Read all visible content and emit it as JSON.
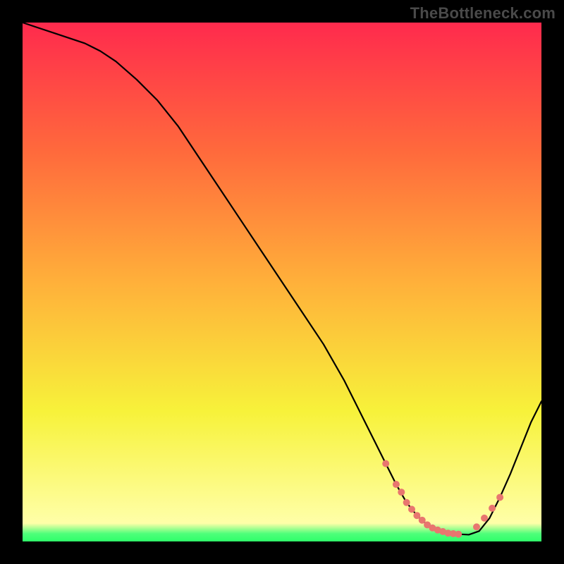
{
  "watermark": "TheBottleneck.com",
  "chart_data": {
    "type": "line",
    "title": "",
    "xlabel": "",
    "ylabel": "",
    "xlim": [
      0,
      100
    ],
    "ylim": [
      0,
      100
    ],
    "series": [
      {
        "name": "curve",
        "x": [
          0,
          3,
          6,
          9,
          12,
          15,
          18,
          22,
          26,
          30,
          34,
          38,
          42,
          46,
          50,
          54,
          58,
          62,
          64,
          66,
          68,
          70,
          72,
          74,
          76,
          78,
          80,
          82,
          84,
          86,
          88,
          90,
          92,
          94,
          96,
          98,
          100
        ],
        "y": [
          100,
          99,
          98,
          97,
          96,
          94.5,
          92.5,
          89,
          85,
          80,
          74,
          68,
          62,
          56,
          50,
          44,
          38,
          31,
          27,
          23,
          19,
          15,
          11,
          7.5,
          5,
          3.2,
          2.2,
          1.6,
          1.4,
          1.3,
          2.0,
          4.5,
          8.5,
          13,
          18,
          23,
          27
        ]
      }
    ],
    "markers": {
      "name": "highlight-dots",
      "x": [
        70,
        72,
        73,
        74,
        75,
        76,
        77,
        78,
        79,
        80,
        81,
        82,
        83,
        84,
        87.5,
        89,
        90.5,
        92
      ],
      "y": [
        15,
        11,
        9.5,
        7.5,
        6.2,
        5,
        4.1,
        3.2,
        2.6,
        2.2,
        1.9,
        1.6,
        1.5,
        1.4,
        2.8,
        4.5,
        6.4,
        8.5
      ]
    },
    "background_gradient": {
      "stops": [
        {
          "offset": 0.0,
          "color": "#ff2a4d"
        },
        {
          "offset": 0.25,
          "color": "#ff6a3c"
        },
        {
          "offset": 0.5,
          "color": "#ffb03a"
        },
        {
          "offset": 0.75,
          "color": "#f7f23a"
        },
        {
          "offset": 0.965,
          "color": "#ffffa8"
        },
        {
          "offset": 0.985,
          "color": "#4eff7a"
        },
        {
          "offset": 1.0,
          "color": "#2fff6a"
        }
      ]
    }
  }
}
